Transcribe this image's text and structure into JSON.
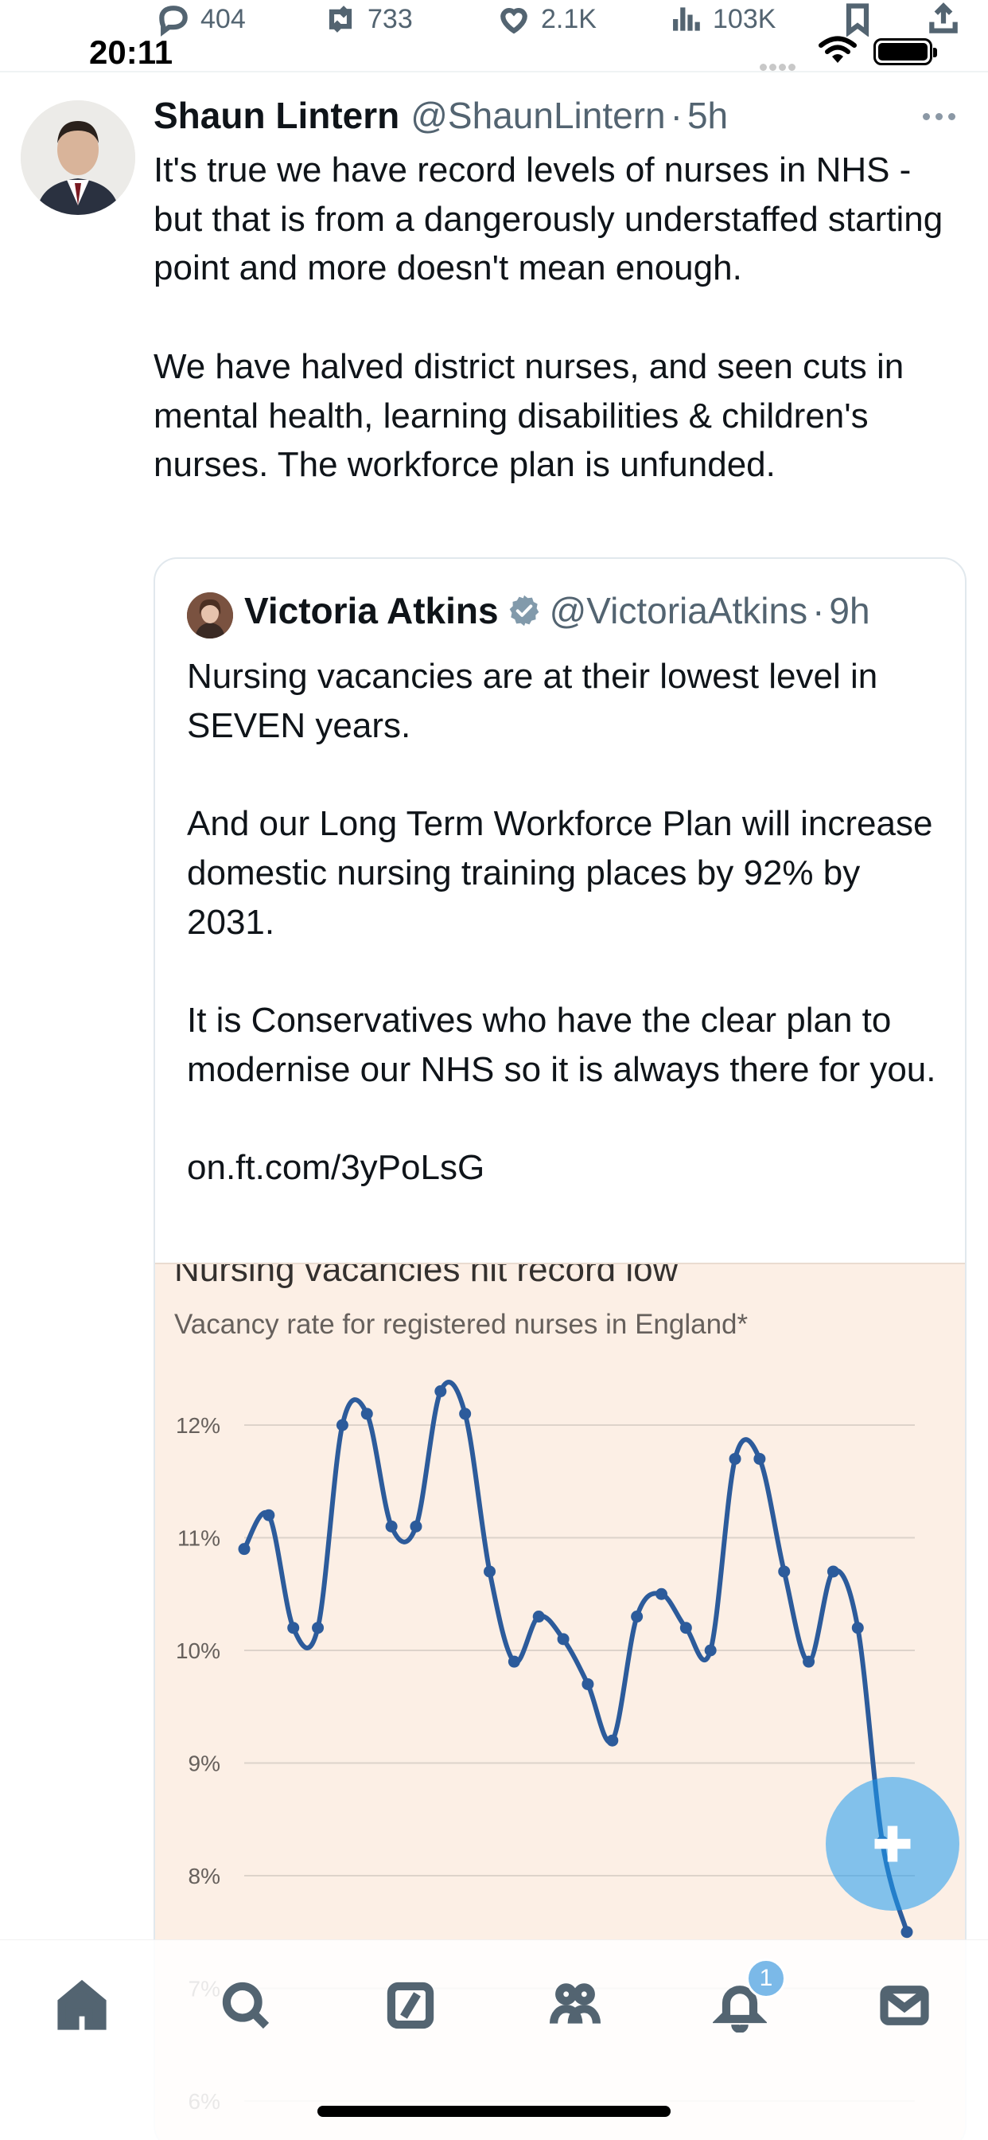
{
  "previous_tweet_actions": {
    "replies": "404",
    "retweets": "733",
    "likes": "2.1K",
    "views": "103K"
  },
  "status_bar": {
    "time": "20:11"
  },
  "tweet": {
    "author_name": "Shaun Lintern",
    "author_handle": "@ShaunLintern",
    "separator": "·",
    "time_ago": "5h",
    "text": "It's true we have record levels of nurses in NHS - but that is from a dangerously understaffed starting point and more doesn't mean enough.\n\nWe have halved district nurses, and seen cuts in mental health, learning disabilities & children's nurses. The workforce plan is unfunded."
  },
  "quoted_tweet": {
    "author_name": "Victoria Atkins",
    "author_handle": "@VictoriaAtkins",
    "separator": "·",
    "time_ago": "9h",
    "text": "Nursing vacancies are at their lowest level in SEVEN years.\n\nAnd our Long Term Workforce Plan will increase domestic nursing training places by 92% by 2031.\n\nIt is Conservatives who have the clear plan to modernise our NHS so it is always there for you.\n\non.ft.com/3yPoLsG"
  },
  "chart_data": {
    "type": "line",
    "title": "Nursing vacancies hit record low",
    "subtitle": "Vacancy rate for registered nurses in England*",
    "y_tick_labels": [
      "12%",
      "11%",
      "10%",
      "9%",
      "8%",
      "7%",
      "6%"
    ],
    "y_ticks": [
      12,
      11,
      10,
      9,
      8,
      7,
      6
    ],
    "ylim": [
      6,
      12.5
    ],
    "grid": true,
    "series_color": "#2c5b9b",
    "background": "#fcefe5",
    "values": [
      10.9,
      11.2,
      10.2,
      10.2,
      12.0,
      12.1,
      11.1,
      11.1,
      12.3,
      12.1,
      10.7,
      9.9,
      10.3,
      10.1,
      9.7,
      9.2,
      10.3,
      10.5,
      10.2,
      10.0,
      11.7,
      11.7,
      10.7,
      9.9,
      10.7,
      10.2,
      8.3,
      7.5
    ]
  },
  "notifications_badge": "1",
  "icons": {
    "reply": "reply-icon",
    "retweet": "retweet-icon",
    "like": "heart-icon",
    "views": "views-icon",
    "bookmark": "bookmark-icon",
    "share": "share-icon",
    "verified": "verified-badge-icon",
    "compose": "plus-icon",
    "home": "home-icon",
    "search": "search-icon",
    "grok": "grok-icon",
    "communities": "communities-icon",
    "notifications": "bell-icon",
    "messages": "mail-icon"
  },
  "colors": {
    "accent": "#1d9bf0",
    "verified_badge": "#829aab",
    "line": "#2c5b9b"
  }
}
